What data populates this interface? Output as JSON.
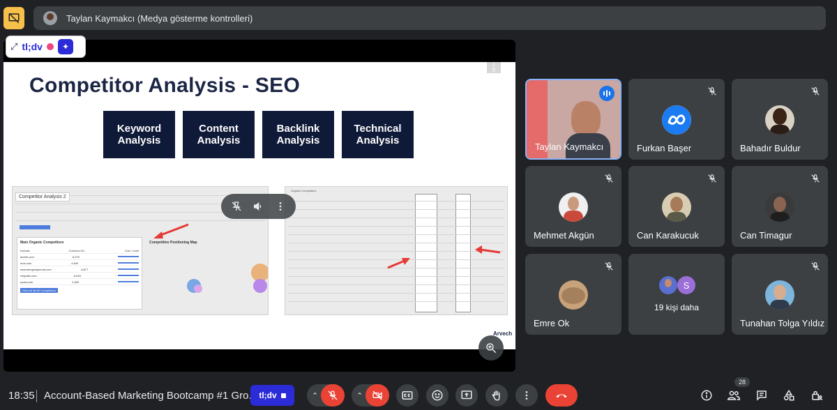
{
  "presenter": {
    "banner_text": "Taylan Kaymakcı (Medya gösterme kontrolleri)"
  },
  "tldv": {
    "chip_logo": "tl;dv",
    "button_label": "tl;dv"
  },
  "slide": {
    "page_marker": "1\n9",
    "title": "Competitor Analysis - SEO",
    "boxes": [
      "Keyword\nAnalysis",
      "Content\nAnalysis",
      "Backlink\nAnalysis",
      "Technical\nAnalysis"
    ],
    "left_overlay_label": "Competitor Analysis 2",
    "panel_heading": "Main Organic Competitors",
    "panel_columns": [
      "Domain",
      "Common Ke..",
      "Com. Level"
    ],
    "panel_rows": [
      [
        "ahrefs.com",
        "8,375"
      ],
      [
        "moz.com",
        "4,640"
      ],
      [
        "searchenginejournal.com",
        "8,877"
      ],
      [
        "neilpatel.com",
        "8,545"
      ],
      [
        "yoast.com",
        "2,650"
      ]
    ],
    "panel_button": "View all 36.8K Competitors",
    "map_heading": "Competitive Positioning Map",
    "right_heading": "Organic Competitors",
    "corner_logo": "Arvech"
  },
  "participants": [
    {
      "name": "Taylan Kaymakcı",
      "speaking": true
    },
    {
      "name": "Furkan Başer"
    },
    {
      "name": "Bahadır Buldur"
    },
    {
      "name": "Mehmet Akgün"
    },
    {
      "name": "Can Karakucuk"
    },
    {
      "name": "Can Timagur"
    },
    {
      "name": "Emre Ok"
    },
    {
      "name": "19 kişi daha",
      "initial": "S"
    },
    {
      "name": "Tunahan Tolga Yıldız"
    }
  ],
  "bottom": {
    "time": "18:35",
    "meeting_title": "Account-Based Marketing Bootcamp #1 Gro...",
    "participant_count": "28"
  },
  "colors": {
    "background": "#202124",
    "tile": "#3c4043",
    "accent_blue": "#8ab4f8",
    "danger_red": "#ea4335",
    "tldv_blue": "#2c2bd8",
    "present_yellow": "#f6c04a"
  }
}
